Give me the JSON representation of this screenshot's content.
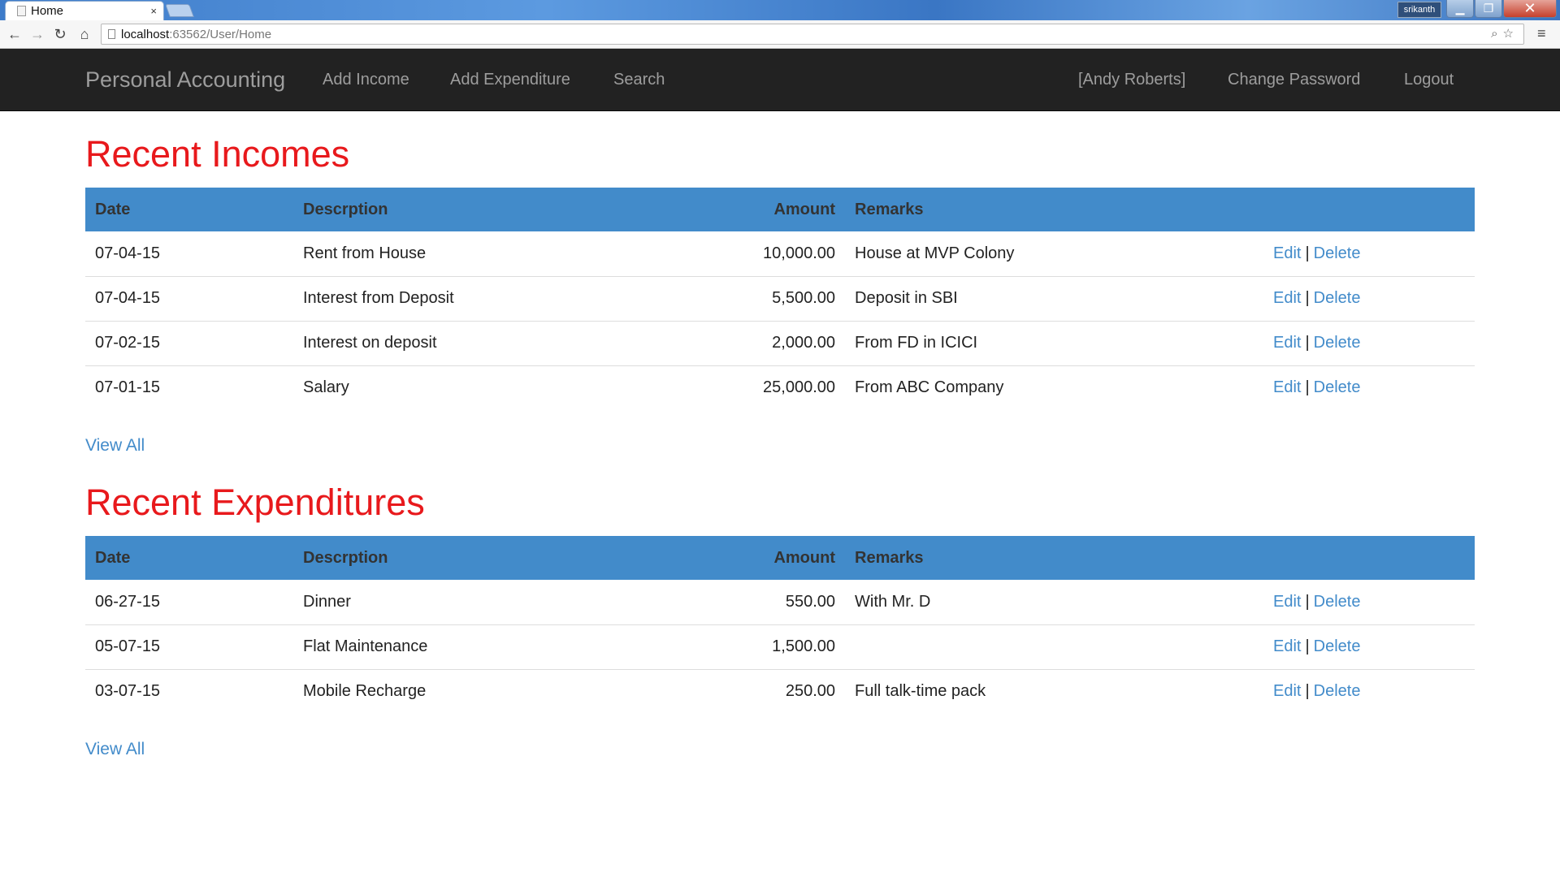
{
  "browser": {
    "tab_title": "Home",
    "tab_close": "×",
    "window_user": "srikanth",
    "url_host": "localhost",
    "url_path": ":63562/User/Home"
  },
  "navbar": {
    "brand": "Personal Accounting",
    "links": [
      "Add Income",
      "Add Expenditure",
      "Search"
    ],
    "user": "[Andy Roberts]",
    "change_password": "Change Password",
    "logout": "Logout"
  },
  "columns": {
    "date": "Date",
    "description": "Descrption",
    "amount": "Amount",
    "remarks": "Remarks"
  },
  "actions": {
    "edit": "Edit",
    "separator": "|",
    "delete": "Delete"
  },
  "incomes": {
    "title": "Recent Incomes",
    "view_all": "View All",
    "rows": [
      {
        "date": "07-04-15",
        "description": "Rent from House",
        "amount": "10,000.00",
        "remarks": "House at MVP Colony"
      },
      {
        "date": "07-04-15",
        "description": "Interest from Deposit",
        "amount": "5,500.00",
        "remarks": "Deposit in SBI"
      },
      {
        "date": "07-02-15",
        "description": "Interest on deposit",
        "amount": "2,000.00",
        "remarks": "From FD in ICICI"
      },
      {
        "date": "07-01-15",
        "description": "Salary",
        "amount": "25,000.00",
        "remarks": "From ABC Company"
      }
    ]
  },
  "expenditures": {
    "title": "Recent Expenditures",
    "view_all": "View All",
    "rows": [
      {
        "date": "06-27-15",
        "description": "Dinner",
        "amount": "550.00",
        "remarks": "With Mr. D"
      },
      {
        "date": "05-07-15",
        "description": "Flat Maintenance",
        "amount": "1,500.00",
        "remarks": ""
      },
      {
        "date": "03-07-15",
        "description": "Mobile Recharge",
        "amount": "250.00",
        "remarks": "Full talk-time pack"
      }
    ]
  },
  "colors": {
    "navbar_bg": "#222222",
    "navbar_text": "#9d9d9d",
    "section_title": "#e8191c",
    "table_header_bg": "#428bca",
    "link": "#428bca"
  }
}
